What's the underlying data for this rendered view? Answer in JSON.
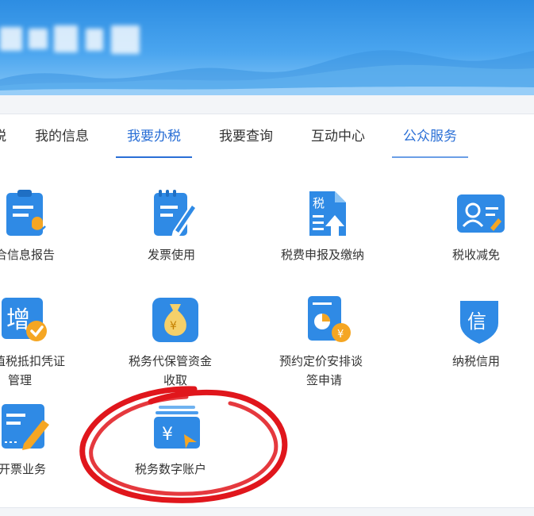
{
  "tabs": [
    {
      "label": "税",
      "active": false
    },
    {
      "label": "我的信息",
      "active": false
    },
    {
      "label": "我要办税",
      "active": true
    },
    {
      "label": "我要查询",
      "active": false
    },
    {
      "label": "互动中心",
      "active": false
    },
    {
      "label": "公众服务",
      "active": false
    }
  ],
  "services": {
    "row1": [
      {
        "label": "合信息报告",
        "icon": "info-report-icon"
      },
      {
        "label": "发票使用",
        "icon": "invoice-icon"
      },
      {
        "label": "税费申报及缴纳",
        "icon": "tax-declare-icon"
      },
      {
        "label": "税收减免",
        "icon": "tax-reduction-icon"
      }
    ],
    "row2": [
      {
        "label_line1": "值税抵扣凭证",
        "label_line2": "管理",
        "icon": "vat-deduction-icon"
      },
      {
        "label_line1": "税务代保管资金",
        "label_line2": "收取",
        "icon": "money-bag-icon"
      },
      {
        "label_line1": "预约定价安排谈",
        "label_line2": "签申请",
        "icon": "pricing-arrangement-icon"
      },
      {
        "label": "纳税信用",
        "icon": "credit-shield-icon",
        "icon_char": "信"
      }
    ],
    "row3": [
      {
        "label": "开票业务",
        "icon": "invoicing-icon"
      },
      {
        "label": "税务数字账户",
        "icon": "digital-account-icon",
        "icon_char": "¥"
      }
    ],
    "vat_icon_char": "增",
    "tax_icon_char": "税",
    "money_char": "¥"
  },
  "colors": {
    "accent": "#2a6fd6",
    "icon_blue": "#2f8ae5",
    "icon_orange": "#f5a623",
    "marker_red": "#e0161c"
  }
}
